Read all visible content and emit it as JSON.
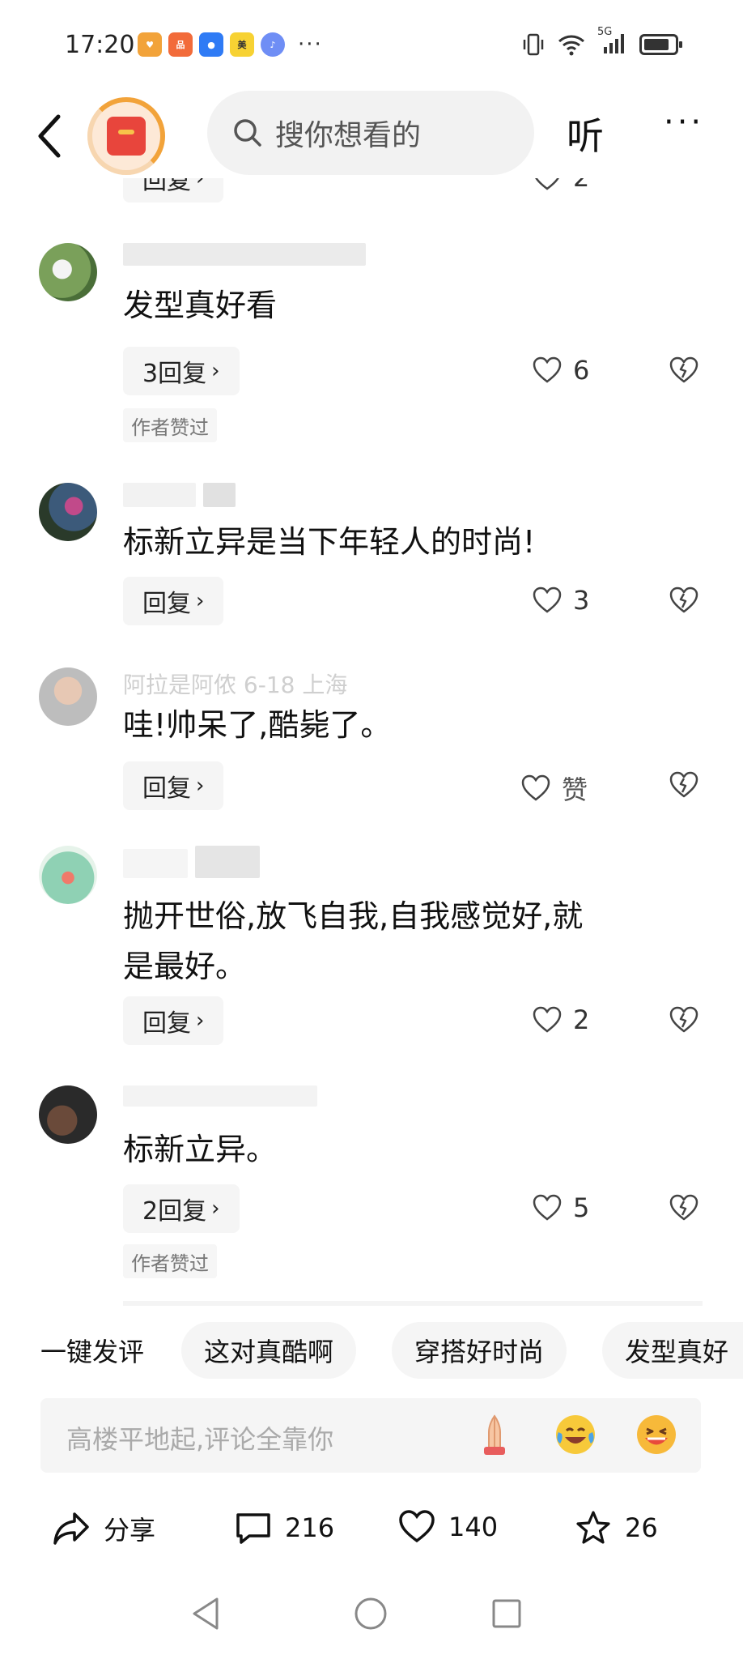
{
  "status_bar": {
    "time": "17:20",
    "network": "5G",
    "more": "···"
  },
  "nav": {
    "search_placeholder": "搜你想看的",
    "listen_label": "听",
    "more_label": "···"
  },
  "top_partial": {
    "reply_label": "回复",
    "like_count": "2"
  },
  "comments": [
    {
      "text": "发型真好看",
      "reply_label": "3回复",
      "likes": "6",
      "tag": "作者赞过"
    },
    {
      "text": "标新立异是当下年轻人的时尚!",
      "reply_label": "回复",
      "likes": "3"
    },
    {
      "meta": "阿拉是阿侬 6-18 上海",
      "text": "哇!帅呆了,酷毙了。",
      "reply_label": "回复",
      "likes": "赞"
    },
    {
      "text_line1": "抛开世俗,放飞自我,自我感觉好,就",
      "text_line2": "是最好。",
      "reply_label": "回复",
      "likes": "2"
    },
    {
      "text": "标新立异。",
      "reply_label": "2回复",
      "likes": "5",
      "tag": "作者赞过"
    }
  ],
  "quick_comment": {
    "label": "一键发评",
    "chips": [
      "这对真酷啊",
      "穿搭好时尚",
      "发型真好"
    ]
  },
  "input": {
    "placeholder": "高楼平地起,评论全靠你"
  },
  "actions": {
    "share_label": "分享",
    "comment_count": "216",
    "like_count": "140",
    "fav_count": "26"
  },
  "colors": {
    "accent_orange": "#f2a33a",
    "brand_red": "#e8453c",
    "chip_bg": "#f5f5f5"
  }
}
